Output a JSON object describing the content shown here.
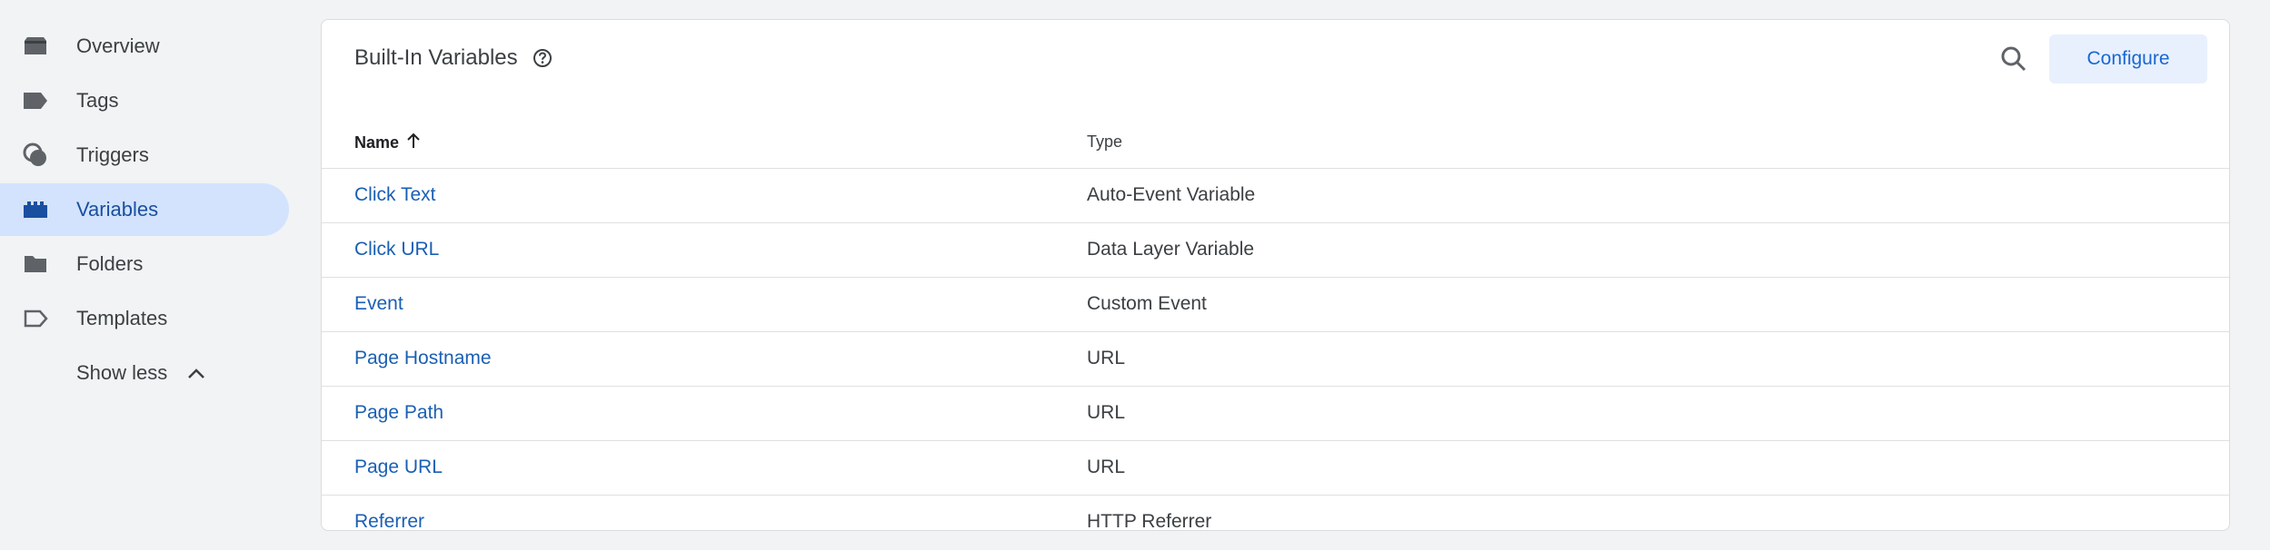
{
  "sidebar": {
    "items": [
      {
        "label": "Overview",
        "icon": "overview-icon"
      },
      {
        "label": "Tags",
        "icon": "tag-icon"
      },
      {
        "label": "Triggers",
        "icon": "triggers-icon"
      },
      {
        "label": "Variables",
        "icon": "variables-icon",
        "active": true
      },
      {
        "label": "Folders",
        "icon": "folder-icon"
      },
      {
        "label": "Templates",
        "icon": "templates-icon"
      }
    ],
    "show_less_label": "Show less"
  },
  "card": {
    "title": "Built-In Variables",
    "configure_label": "Configure",
    "columns": {
      "name": "Name",
      "type": "Type"
    },
    "rows": [
      {
        "name": "Click Text",
        "type": "Auto-Event Variable"
      },
      {
        "name": "Click URL",
        "type": "Data Layer Variable"
      },
      {
        "name": "Event",
        "type": "Custom Event"
      },
      {
        "name": "Page Hostname",
        "type": "URL"
      },
      {
        "name": "Page Path",
        "type": "URL"
      },
      {
        "name": "Page URL",
        "type": "URL"
      },
      {
        "name": "Referrer",
        "type": "HTTP Referrer"
      }
    ]
  },
  "colors": {
    "accent": "#1a73e8",
    "active_nav_bg": "#d3e3fd",
    "link": "#1a5fb4",
    "button_bg": "#e8f0fe"
  }
}
